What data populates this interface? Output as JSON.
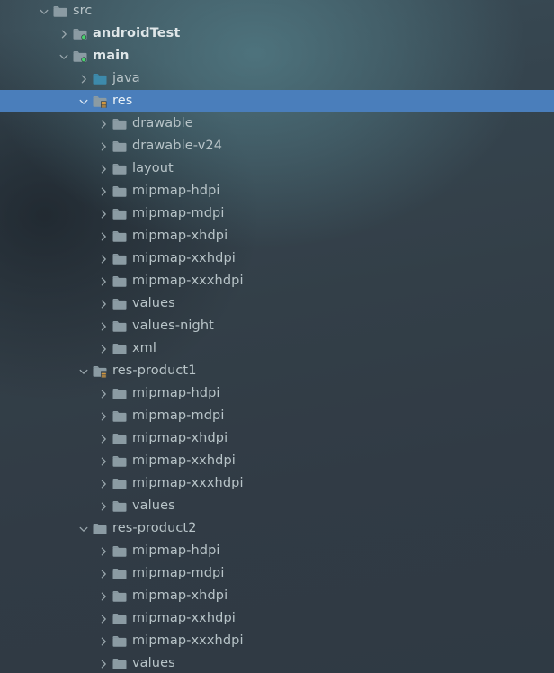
{
  "theme": {
    "selection_color": "#4a7ebb",
    "text_color": "#b8c4c8",
    "source_set_text_color": "#dfe6e8",
    "folder_gray": "#8b9ba3",
    "folder_blue": "#3d8aab",
    "badge_green": "#4ad16e",
    "badge_orange": "#e8a33d",
    "background_top": "#3d5b63",
    "background_bottom": "#2f3a44"
  },
  "tree": {
    "name": "project-file-tree",
    "rows": [
      {
        "label": "src",
        "depth": 1,
        "twisty": "expanded",
        "icon": "folder",
        "bold": false,
        "selected": false
      },
      {
        "label": "androidTest",
        "depth": 2,
        "twisty": "collapsed",
        "icon": "folder-source",
        "bold": true,
        "selected": false
      },
      {
        "label": "main",
        "depth": 2,
        "twisty": "expanded",
        "icon": "folder-source",
        "bold": true,
        "selected": false
      },
      {
        "label": "java",
        "depth": 3,
        "twisty": "collapsed",
        "icon": "folder-java",
        "bold": false,
        "selected": false
      },
      {
        "label": "res",
        "depth": 3,
        "twisty": "expanded",
        "icon": "folder-resource",
        "bold": false,
        "selected": true
      },
      {
        "label": "drawable",
        "depth": 4,
        "twisty": "collapsed",
        "icon": "folder",
        "bold": false,
        "selected": false
      },
      {
        "label": "drawable-v24",
        "depth": 4,
        "twisty": "collapsed",
        "icon": "folder",
        "bold": false,
        "selected": false
      },
      {
        "label": "layout",
        "depth": 4,
        "twisty": "collapsed",
        "icon": "folder",
        "bold": false,
        "selected": false
      },
      {
        "label": "mipmap-hdpi",
        "depth": 4,
        "twisty": "collapsed",
        "icon": "folder",
        "bold": false,
        "selected": false
      },
      {
        "label": "mipmap-mdpi",
        "depth": 4,
        "twisty": "collapsed",
        "icon": "folder",
        "bold": false,
        "selected": false
      },
      {
        "label": "mipmap-xhdpi",
        "depth": 4,
        "twisty": "collapsed",
        "icon": "folder",
        "bold": false,
        "selected": false
      },
      {
        "label": "mipmap-xxhdpi",
        "depth": 4,
        "twisty": "collapsed",
        "icon": "folder",
        "bold": false,
        "selected": false
      },
      {
        "label": "mipmap-xxxhdpi",
        "depth": 4,
        "twisty": "collapsed",
        "icon": "folder",
        "bold": false,
        "selected": false
      },
      {
        "label": "values",
        "depth": 4,
        "twisty": "collapsed",
        "icon": "folder",
        "bold": false,
        "selected": false
      },
      {
        "label": "values-night",
        "depth": 4,
        "twisty": "collapsed",
        "icon": "folder",
        "bold": false,
        "selected": false
      },
      {
        "label": "xml",
        "depth": 4,
        "twisty": "collapsed",
        "icon": "folder",
        "bold": false,
        "selected": false
      },
      {
        "label": "res-product1",
        "depth": 3,
        "twisty": "expanded",
        "icon": "folder-resource",
        "bold": false,
        "selected": false
      },
      {
        "label": "mipmap-hdpi",
        "depth": 4,
        "twisty": "collapsed",
        "icon": "folder",
        "bold": false,
        "selected": false
      },
      {
        "label": "mipmap-mdpi",
        "depth": 4,
        "twisty": "collapsed",
        "icon": "folder",
        "bold": false,
        "selected": false
      },
      {
        "label": "mipmap-xhdpi",
        "depth": 4,
        "twisty": "collapsed",
        "icon": "folder",
        "bold": false,
        "selected": false
      },
      {
        "label": "mipmap-xxhdpi",
        "depth": 4,
        "twisty": "collapsed",
        "icon": "folder",
        "bold": false,
        "selected": false
      },
      {
        "label": "mipmap-xxxhdpi",
        "depth": 4,
        "twisty": "collapsed",
        "icon": "folder",
        "bold": false,
        "selected": false
      },
      {
        "label": "values",
        "depth": 4,
        "twisty": "collapsed",
        "icon": "folder",
        "bold": false,
        "selected": false
      },
      {
        "label": "res-product2",
        "depth": 3,
        "twisty": "expanded",
        "icon": "folder",
        "bold": false,
        "selected": false
      },
      {
        "label": "mipmap-hdpi",
        "depth": 4,
        "twisty": "collapsed",
        "icon": "folder",
        "bold": false,
        "selected": false
      },
      {
        "label": "mipmap-mdpi",
        "depth": 4,
        "twisty": "collapsed",
        "icon": "folder",
        "bold": false,
        "selected": false
      },
      {
        "label": "mipmap-xhdpi",
        "depth": 4,
        "twisty": "collapsed",
        "icon": "folder",
        "bold": false,
        "selected": false
      },
      {
        "label": "mipmap-xxhdpi",
        "depth": 4,
        "twisty": "collapsed",
        "icon": "folder",
        "bold": false,
        "selected": false
      },
      {
        "label": "mipmap-xxxhdpi",
        "depth": 4,
        "twisty": "collapsed",
        "icon": "folder",
        "bold": false,
        "selected": false
      },
      {
        "label": "values",
        "depth": 4,
        "twisty": "collapsed",
        "icon": "folder",
        "bold": false,
        "selected": false
      }
    ]
  }
}
